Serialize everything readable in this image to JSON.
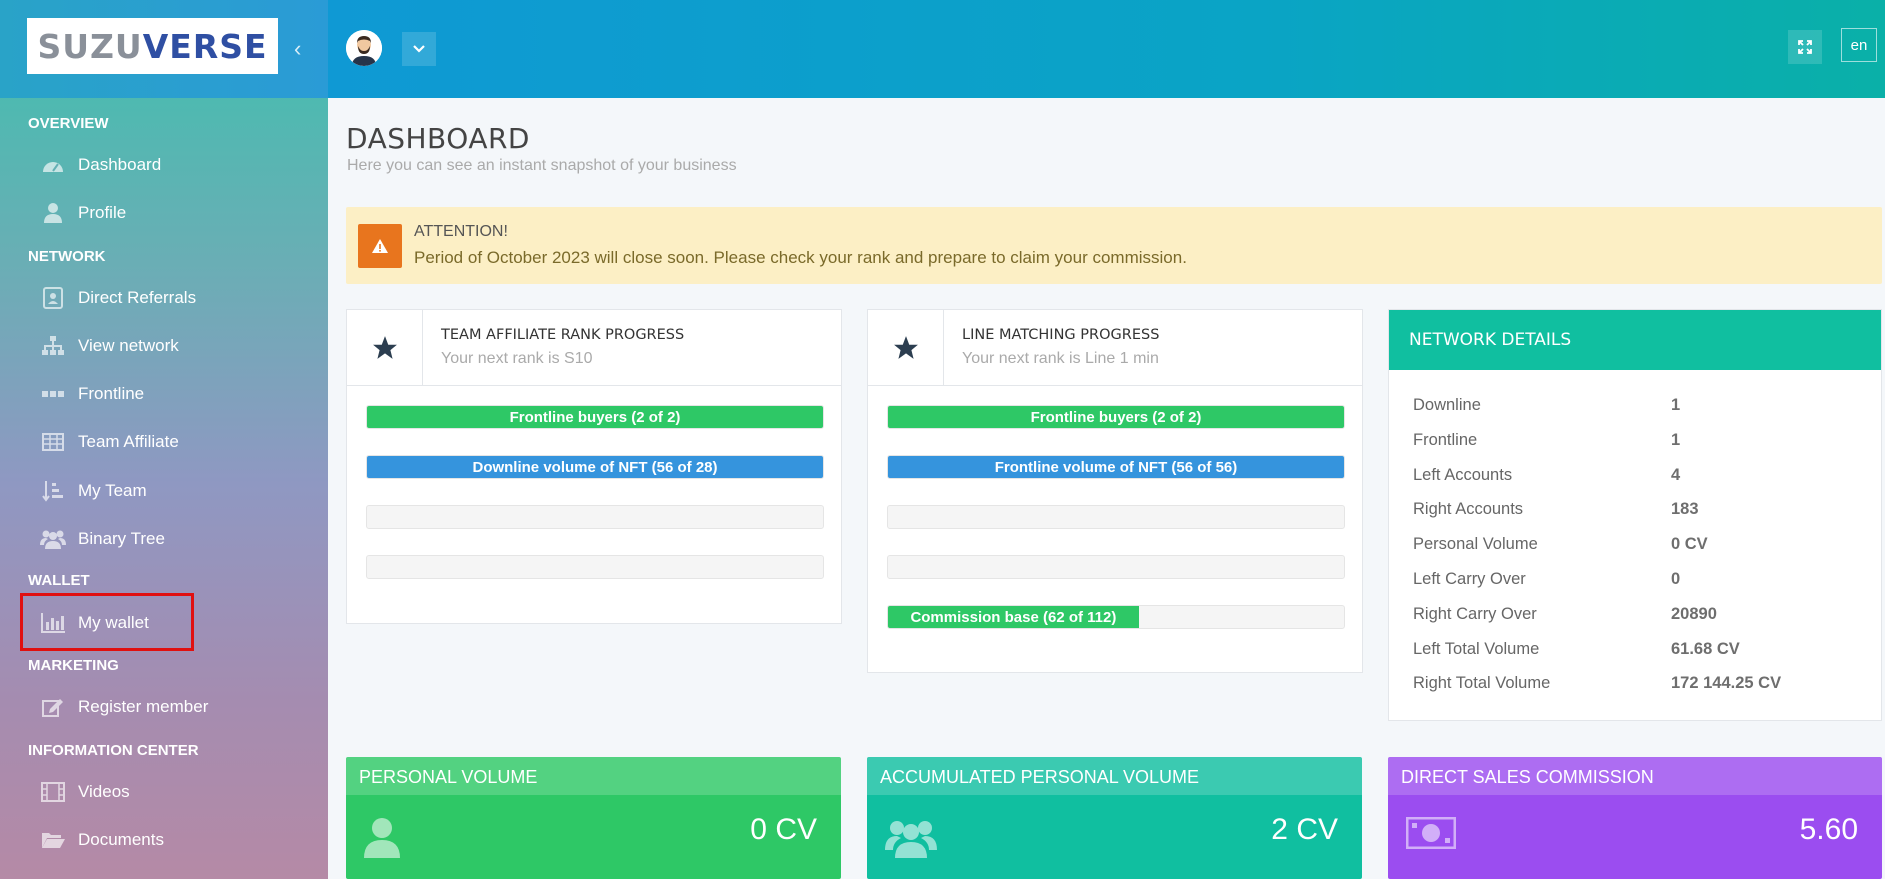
{
  "brand": {
    "logo_part1": "SUZU",
    "logo_part2": "VERSE"
  },
  "topbar": {
    "lang": "en"
  },
  "sidebar": {
    "sections": [
      {
        "label": "OVERVIEW",
        "items": [
          {
            "label": "Dashboard",
            "icon": "dashboard-icon"
          },
          {
            "label": "Profile",
            "icon": "user-icon"
          }
        ]
      },
      {
        "label": "NETWORK",
        "items": [
          {
            "label": "Direct Referrals",
            "icon": "id-card-icon"
          },
          {
            "label": "View network",
            "icon": "sitemap-icon"
          },
          {
            "label": "Frontline",
            "icon": "ellipsis-icon"
          },
          {
            "label": "Team Affiliate",
            "icon": "table-icon"
          },
          {
            "label": "My Team",
            "icon": "sort-list-icon"
          },
          {
            "label": "Binary Tree",
            "icon": "users-icon"
          }
        ]
      },
      {
        "label": "WALLET",
        "items": [
          {
            "label": "My wallet",
            "icon": "bar-chart-icon"
          }
        ]
      },
      {
        "label": "MARKETING",
        "items": [
          {
            "label": "Register member",
            "icon": "edit-icon"
          }
        ]
      },
      {
        "label": "INFORMATION CENTER",
        "items": [
          {
            "label": "Videos",
            "icon": "film-icon"
          },
          {
            "label": "Documents",
            "icon": "folder-icon"
          }
        ]
      }
    ]
  },
  "page": {
    "title": "DASHBOARD",
    "subtitle": "Here you can see an instant snapshot of your business"
  },
  "alert": {
    "title": "ATTENTION!",
    "message": "Period of October 2023 will close soon. Please check your rank and prepare to claim your commission."
  },
  "rank_card": {
    "title": "TEAM AFFILIATE RANK PROGRESS",
    "subtitle": "Your next rank is S10",
    "bars": [
      {
        "label": "Frontline buyers (2 of 2)",
        "progress": 1.0,
        "color": "#2ec866"
      },
      {
        "label": "Downline volume of NFT (56 of 28)",
        "progress": 1.0,
        "color": "#3594dd"
      },
      {
        "label": "",
        "progress": 0
      },
      {
        "label": "",
        "progress": 0
      }
    ]
  },
  "line_card": {
    "title": "LINE MATCHING PROGRESS",
    "subtitle": "Your next rank is Line 1 min",
    "bars": [
      {
        "label": "Frontline buyers (2 of 2)",
        "progress": 1.0,
        "color": "#2ec866"
      },
      {
        "label": "Frontline volume of NFT (56 of 56)",
        "progress": 1.0,
        "color": "#3594dd"
      },
      {
        "label": "",
        "progress": 0
      },
      {
        "label": "",
        "progress": 0
      },
      {
        "label": "Commission base (62 of 112)",
        "progress": 0.55,
        "color": "#2ec866"
      }
    ]
  },
  "network": {
    "title": "NETWORK DETAILS",
    "rows": [
      {
        "label": "Downline",
        "value": "1"
      },
      {
        "label": "Frontline",
        "value": "1"
      },
      {
        "label": "Left Accounts",
        "value": "4"
      },
      {
        "label": "Right Accounts",
        "value": "183"
      },
      {
        "label": "Personal Volume",
        "value": "0 CV"
      },
      {
        "label": "Left Carry Over",
        "value": "0"
      },
      {
        "label": "Right Carry Over",
        "value": "20890"
      },
      {
        "label": "Left Total Volume",
        "value": "61.68 CV"
      },
      {
        "label": "Right Total Volume",
        "value": "172 144.25 CV"
      }
    ]
  },
  "stats": [
    {
      "title": "PERSONAL VOLUME",
      "value": "0 CV",
      "color": "#2ec866",
      "icon": "user-icon"
    },
    {
      "title": "ACCUMULATED PERSONAL VOLUME",
      "value": "2 CV",
      "color": "#10bfa0",
      "icon": "users-icon"
    },
    {
      "title": "DIRECT SALES COMMISSION",
      "value": "5.60",
      "color": "#9b4df0",
      "icon": "money-icon"
    }
  ]
}
